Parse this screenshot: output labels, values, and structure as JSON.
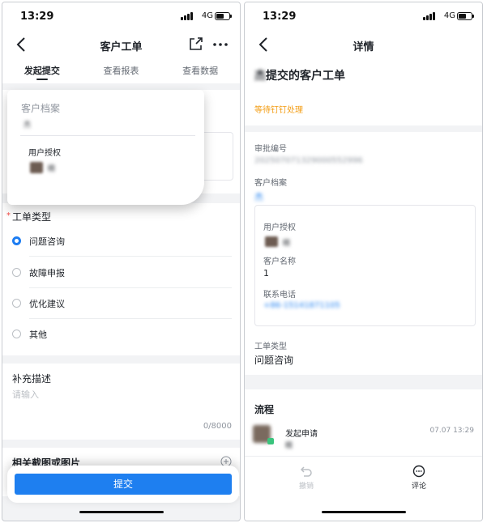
{
  "status": {
    "time": "13:29",
    "network": "4G"
  },
  "left": {
    "nav_title": "客户工单",
    "tabs": [
      "发起提交",
      "查看报表",
      "查看数据"
    ],
    "customer_file": {
      "label": "客户档案",
      "value": "杰"
    },
    "user_auth": {
      "label": "用户授权",
      "name": "精"
    },
    "ticket_type": {
      "required_mark": "*",
      "label": "工单类型",
      "options": [
        "问题咨询",
        "故障申报",
        "优化建议",
        "其他"
      ],
      "selected_index": 0
    },
    "supplement": {
      "label": "补充描述",
      "placeholder": "请输入",
      "counter": "0/8000"
    },
    "screenshot_label": "相关截图或图片",
    "submit_label": "提交"
  },
  "right": {
    "nav_title": "详情",
    "heading_blur": "杰",
    "heading": "提交的客户工单",
    "status_text": "等待钉钉处理",
    "approval_no": {
      "label": "审批编号",
      "value": "202507071329000552996"
    },
    "customer_file": {
      "label": "客户档案",
      "value": "杰"
    },
    "inner": {
      "user_auth_label": "用户授权",
      "user_auth_name": "精",
      "customer_name_label": "客户名称",
      "customer_name_value": "1",
      "phone_label": "联系电话",
      "phone_value": "+86-15141871105"
    },
    "ticket_type": {
      "label": "工单类型",
      "value": "问题咨询"
    },
    "flow": {
      "title": "流程",
      "step": "发起申请",
      "time": "07.07 13:29",
      "person": "精"
    },
    "actions": {
      "withdraw": "撤销",
      "comment": "评论"
    }
  },
  "colors": {
    "accent": "#1e7ff0",
    "status_orange": "#f39c12"
  },
  "icons": [
    "back-icon",
    "share-icon",
    "more-icon",
    "add-icon",
    "undo-icon",
    "comment-icon"
  ]
}
